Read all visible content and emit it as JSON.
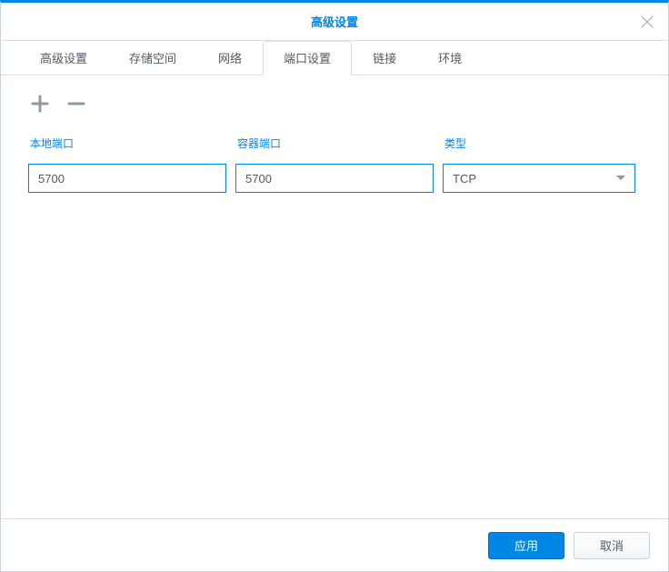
{
  "dialog": {
    "title": "高级设置"
  },
  "tabs": [
    {
      "label": "高级设置"
    },
    {
      "label": "存储空间"
    },
    {
      "label": "网络"
    },
    {
      "label": "端口设置"
    },
    {
      "label": "链接"
    },
    {
      "label": "环境"
    }
  ],
  "columns": {
    "local_port": "本地端口",
    "container_port": "容器端口",
    "type": "类型"
  },
  "rows": [
    {
      "local_port": "5700",
      "container_port": "5700",
      "type": "TCP"
    }
  ],
  "buttons": {
    "apply": "应用",
    "cancel": "取消"
  }
}
